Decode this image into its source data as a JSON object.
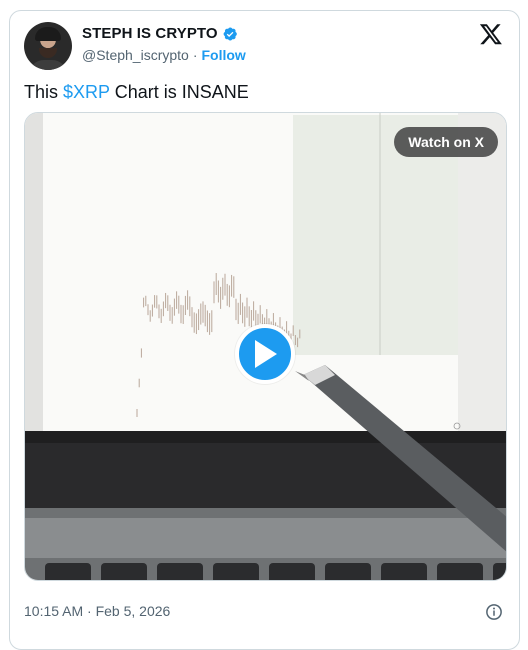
{
  "author": {
    "name": "STEPH IS CRYPTO",
    "handle": "@Steph_iscrypto",
    "separator": "·",
    "follow_label": "Follow",
    "verified_icon": "verified-badge-icon",
    "avatar_alt": "profile photo"
  },
  "brand": {
    "logo": "x-logo-icon"
  },
  "tweet": {
    "text_prefix": "This ",
    "cashtag": "$XRP",
    "text_suffix": " Chart is INSANE"
  },
  "media": {
    "watch_label": "Watch on X",
    "play_icon": "play-icon"
  },
  "timestamp": "10:15 AM · Feb 5, 2026",
  "colors": {
    "accent": "#1d9bf0",
    "text": "#0f1419",
    "muted": "#536471",
    "border": "#cfd9de"
  }
}
